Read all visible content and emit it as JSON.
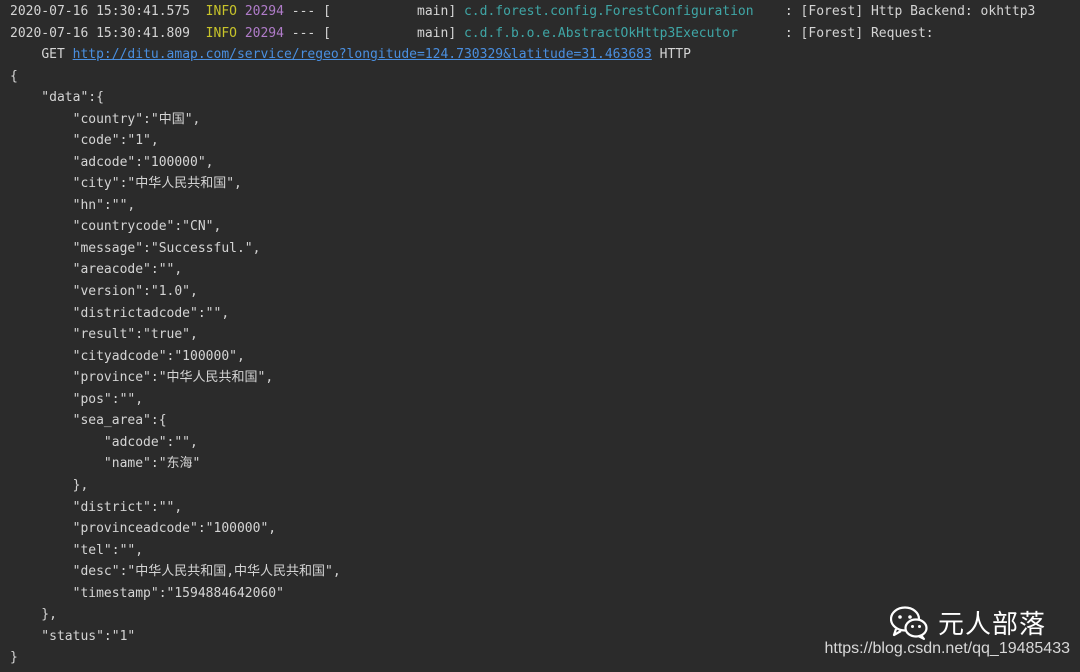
{
  "log_lines": [
    {
      "timestamp": "2020-07-16 15:30:41.575",
      "level": "INFO",
      "pid": "20294",
      "sep": "--- [",
      "thread": "main]",
      "logger": "c.d.forest.config.ForestConfiguration",
      "message": ": [Forest] Http Backend: okhttp3"
    },
    {
      "timestamp": "2020-07-16 15:30:41.809",
      "level": "INFO",
      "pid": "20294",
      "sep": "--- [",
      "thread": "main]",
      "logger": "c.d.f.b.o.e.AbstractOkHttp3Executor",
      "message": ": [Forest] Request:"
    }
  ],
  "request": {
    "method": "GET",
    "url": "http://ditu.amap.com/service/regeo?longitude=124.730329&latitude=31.463683",
    "protocol": "HTTP"
  },
  "json_lines": [
    "{",
    "    \"data\":{",
    "        \"country\":\"中国\",",
    "        \"code\":\"1\",",
    "        \"adcode\":\"100000\",",
    "        \"city\":\"中华人民共和国\",",
    "        \"hn\":\"\",",
    "        \"countrycode\":\"CN\",",
    "        \"message\":\"Successful.\",",
    "        \"areacode\":\"\",",
    "        \"version\":\"1.0\",",
    "        \"districtadcode\":\"\",",
    "        \"result\":\"true\",",
    "        \"cityadcode\":\"100000\",",
    "        \"province\":\"中华人民共和国\",",
    "        \"pos\":\"\",",
    "        \"sea_area\":{",
    "            \"adcode\":\"\",",
    "            \"name\":\"东海\"",
    "        },",
    "        \"district\":\"\",",
    "        \"provinceadcode\":\"100000\",",
    "        \"tel\":\"\",",
    "        \"desc\":\"中华人民共和国,中华人民共和国\",",
    "        \"timestamp\":\"1594884642060\"",
    "    },",
    "    \"status\":\"1\"",
    "}"
  ],
  "watermark": {
    "brand_text": "元人部落",
    "url_text": "https://blog.csdn.net/qq_19485433"
  },
  "colors": {
    "background": "#2b2b2b",
    "text": "#d4d4d4",
    "info": "#c8c42a",
    "pid": "#b07cc9",
    "logger": "#3fa6a6",
    "link": "#4a8fe0"
  },
  "icons": {
    "watermark_icon": "wechat-icon"
  }
}
